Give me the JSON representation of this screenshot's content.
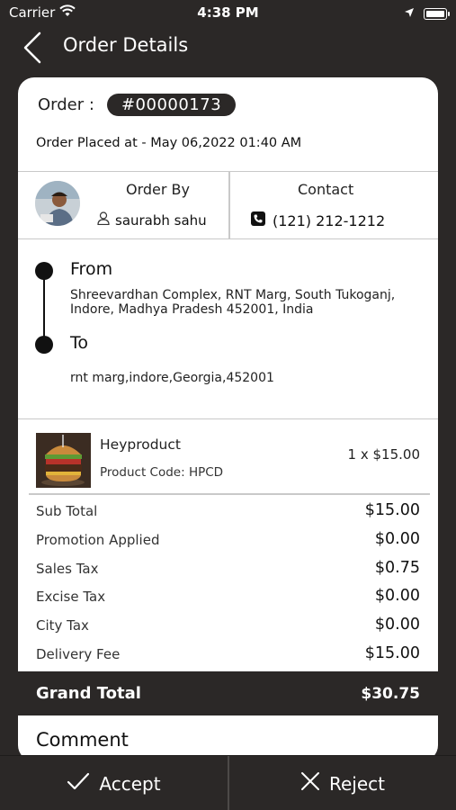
{
  "status_bar": {
    "carrier": "Carrier",
    "time": "4:38 PM",
    "icons": [
      "wifi-icon",
      "location-arrow-icon",
      "battery-icon"
    ]
  },
  "nav": {
    "title": "Order Details",
    "back_icon": "chevron-left-icon"
  },
  "order": {
    "label": "Order :",
    "number": "#00000173",
    "placed_at": "Order Placed at - May 06,2022 01:40 AM"
  },
  "order_by": {
    "label": "Order By",
    "name": "saurabh sahu",
    "user_icon": "user-icon"
  },
  "contact": {
    "label": "Contact",
    "phone": "(121) 212-1212",
    "phone_icon": "phone-icon"
  },
  "route": {
    "from_label": "From",
    "from_address": "Shreevardhan Complex, RNT Marg, South Tukoganj, Indore, Madhya Pradesh 452001, India",
    "to_label": "To",
    "to_address": "rnt marg,indore,Georgia,452001"
  },
  "product": {
    "name": "Heyproduct",
    "code": "Product Code: HPCD",
    "quantity_price": "1 x $15.00"
  },
  "totals": [
    {
      "label": "Sub Total",
      "value": "$15.00"
    },
    {
      "label": "Promotion Applied",
      "value": "$0.00"
    },
    {
      "label": "Sales Tax",
      "value": "$0.75"
    },
    {
      "label": "Excise Tax",
      "value": "$0.00"
    },
    {
      "label": "City Tax",
      "value": "$0.00"
    },
    {
      "label": "Delivery Fee",
      "value": "$15.00"
    }
  ],
  "grand_total": {
    "label": "Grand Total",
    "value": "$30.75"
  },
  "comment": {
    "label": "Comment"
  },
  "actions": {
    "accept": "Accept",
    "reject": "Reject"
  },
  "colors": {
    "dark": "#2b2827",
    "card": "#ffffff",
    "divider": "#c9c9c9"
  }
}
